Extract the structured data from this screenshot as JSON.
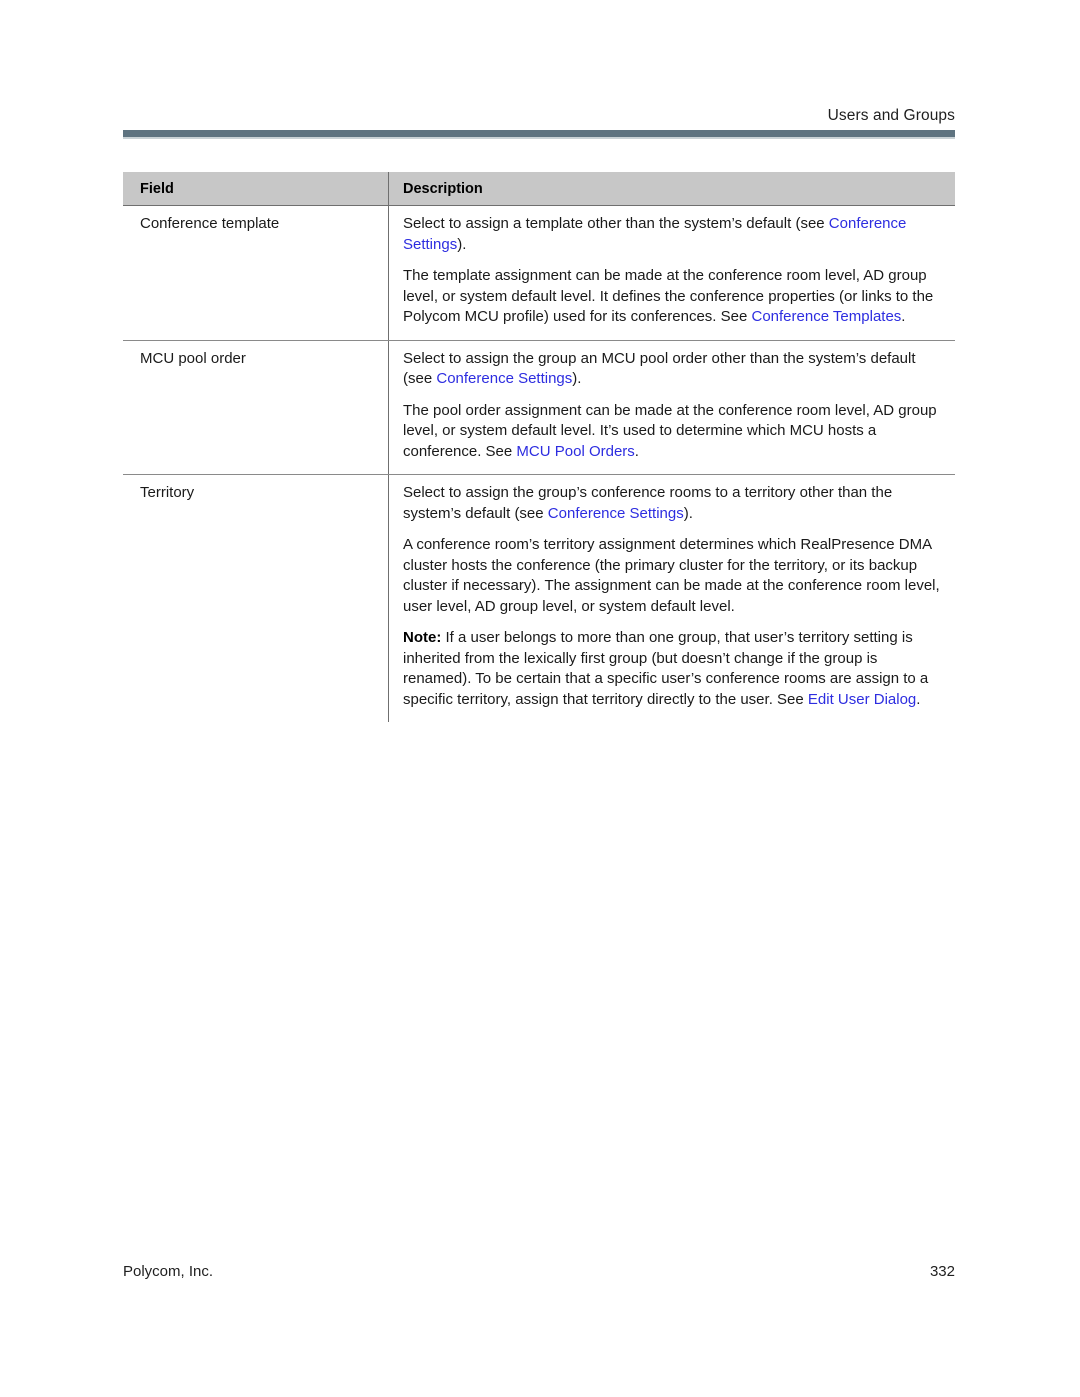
{
  "header": {
    "running_title": "Users and Groups"
  },
  "table": {
    "columns": [
      "Field",
      "Description"
    ],
    "rows": [
      {
        "field": "Conference template",
        "paragraphs": [
          [
            {
              "t": "Select to assign a template other than the system’s default (see ",
              "link": false
            },
            {
              "t": "Conference Settings",
              "link": true
            },
            {
              "t": ").",
              "link": false
            }
          ],
          [
            {
              "t": "The template assignment can be made at the conference room level, AD group level, or system default level. It defines the conference properties (or links to the Polycom MCU profile) used for its conferences. See ",
              "link": false
            },
            {
              "t": "Conference Templates",
              "link": true
            },
            {
              "t": ".",
              "link": false
            }
          ]
        ]
      },
      {
        "field": "MCU pool order",
        "paragraphs": [
          [
            {
              "t": "Select to assign the group an MCU pool order other than the system’s default (see ",
              "link": false
            },
            {
              "t": "Conference Settings",
              "link": true
            },
            {
              "t": ").",
              "link": false
            }
          ],
          [
            {
              "t": "The pool order assignment can be made at the conference room level, AD group level, or system default level. It’s used to determine which MCU hosts a conference. See ",
              "link": false
            },
            {
              "t": "MCU Pool Orders",
              "link": true
            },
            {
              "t": ".",
              "link": false
            }
          ]
        ]
      },
      {
        "field": "Territory",
        "paragraphs": [
          [
            {
              "t": "Select to assign the group’s conference rooms to a territory other than the system’s default (see ",
              "link": false
            },
            {
              "t": "Conference Settings",
              "link": true
            },
            {
              "t": ").",
              "link": false
            }
          ],
          [
            {
              "t": "A conference room’s territory assignment determines which RealPresence DMA cluster hosts the conference (the primary cluster for the territory, or its backup cluster if necessary). The assignment can be made at the conference room level, user level, AD group level, or system default level.",
              "link": false
            }
          ],
          [
            {
              "t": "Note:",
              "link": false,
              "bold": true
            },
            {
              "t": " If a user belongs to more than one group, that user’s territory setting is inherited from the lexically first group (but doesn’t change if the group is renamed). To be certain that a specific user’s conference rooms are assign to a specific territory, assign that territory directly to the user. See ",
              "link": false
            },
            {
              "t": "Edit User Dialog",
              "link": true
            },
            {
              "t": ".",
              "link": false
            }
          ]
        ]
      }
    ]
  },
  "footer": {
    "company": "Polycom, Inc.",
    "page_number": "332"
  },
  "colors": {
    "header_rule": "#5e7380",
    "header_rule_shadow": "#c9d2d6",
    "table_header_bg": "#c7c7c7",
    "link": "#2d2de0",
    "text": "#1a1a1a",
    "border": "#6f6f6f"
  }
}
